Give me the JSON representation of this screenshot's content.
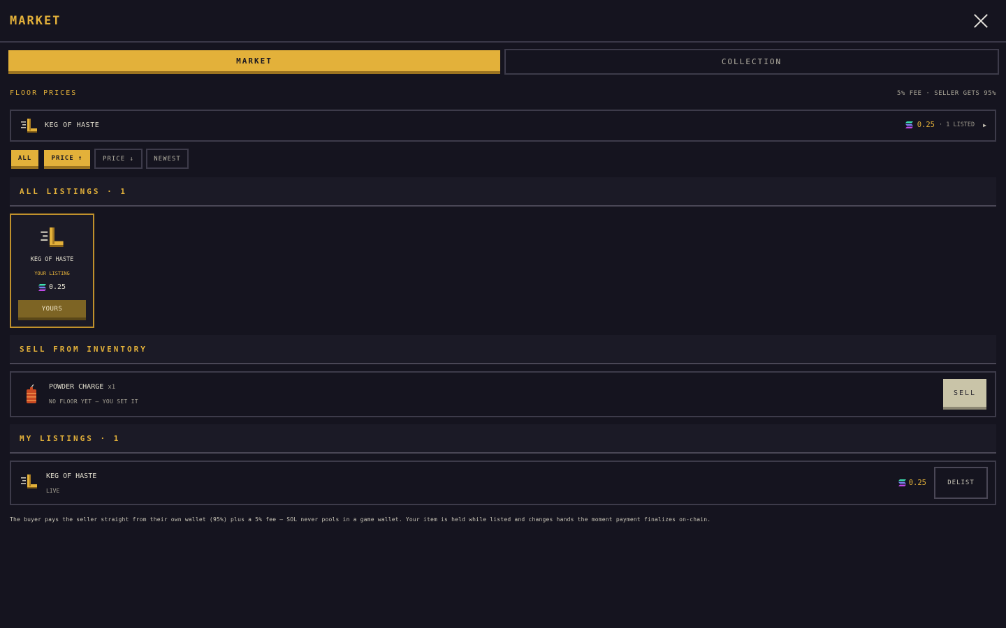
{
  "header": {
    "title": "MARKET",
    "close_icon": "close-icon"
  },
  "tabs": [
    {
      "label": "MARKET",
      "active": true
    },
    {
      "label": "COLLECTION",
      "active": false
    }
  ],
  "floor": {
    "label": "FLOOR PRICES",
    "fee_note": "5% FEE · SELLER GETS 95%",
    "rows": [
      {
        "name": "KEG OF HASTE",
        "price": "0.25",
        "listed": "· 1 LISTED",
        "arrow": "▶",
        "icon": "keg-of-haste-icon"
      }
    ]
  },
  "filters": [
    {
      "label": "ALL",
      "active": true
    },
    {
      "label": "PRICE ↑",
      "active": true
    },
    {
      "label": "PRICE ↓",
      "active": false
    },
    {
      "label": "NEWEST",
      "active": false
    }
  ],
  "all_listings": {
    "heading": "ALL LISTINGS · 1",
    "cards": [
      {
        "name": "KEG OF HASTE",
        "sub": "YOUR LISTING",
        "price": "0.25",
        "button": "YOURS",
        "icon": "keg-of-haste-icon"
      }
    ]
  },
  "sell": {
    "heading": "SELL FROM INVENTORY",
    "items": [
      {
        "name": "POWDER CHARGE",
        "qty": "x1",
        "sub": "NO FLOOR YET — YOU SET IT",
        "button": "SELL",
        "icon": "powder-charge-icon"
      }
    ]
  },
  "my_listings": {
    "heading": "MY LISTINGS · 1",
    "items": [
      {
        "name": "KEG OF HASTE",
        "sub": "LIVE",
        "price": "0.25",
        "button": "DELIST",
        "icon": "keg-of-haste-icon"
      }
    ]
  },
  "footnote": "The buyer pays the seller straight from their own wallet (95%) plus a 5% fee — SOL never pools in a game wallet. Your item is held while listed and changes hands the moment payment finalizes on-chain.",
  "colors": {
    "accent": "#e3b13a",
    "background": "#15141f",
    "panel": "#1b1a26",
    "border": "#3d3b4a"
  },
  "currency_icon": "sol-icon"
}
